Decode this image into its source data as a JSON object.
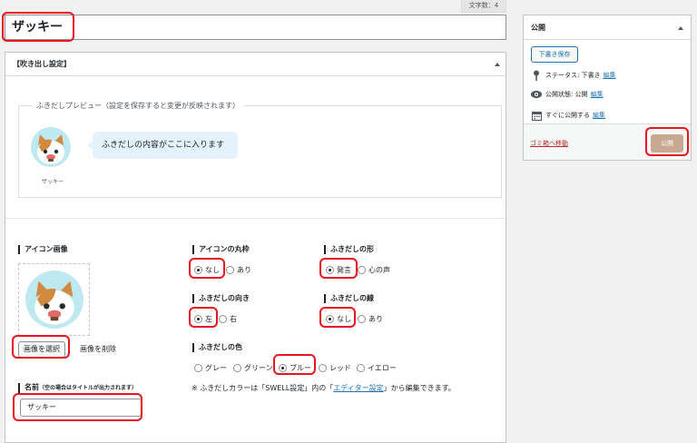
{
  "editor": {
    "char_count": "文字数：4",
    "title_value": "ザッキー"
  },
  "metabox": {
    "title": "【吹き出し設定】",
    "preview_label": "ふきだしプレビュー（設定を保存すると変更が反映されます）",
    "preview_text": "ふきだしの内容がここに入ります",
    "preview_name": "ザッキー",
    "icon_image_label": "アイコン画像",
    "select_image": "画像を選択",
    "remove_image": "画像を削除",
    "name_label": "名前",
    "name_hint": "（空の場合はタイトルが出力されます）",
    "name_value": "ザッキー",
    "icon_round_label": "アイコンの丸枠",
    "icon_round_options": [
      "なし",
      "あり"
    ],
    "bubble_shape_label": "ふきだしの形",
    "bubble_shape_options": [
      "発言",
      "心の声"
    ],
    "direction_label": "ふきだしの向き",
    "direction_options": [
      "左",
      "右"
    ],
    "border_label": "ふきだしの線",
    "border_options": [
      "なし",
      "あり"
    ],
    "color_label": "ふきだしの色",
    "color_options": [
      "グレー",
      "グリーン",
      "ブルー",
      "レッド",
      "イエロー"
    ],
    "note_before": "※ ふきだしカラーは「SWELL設定」内の「",
    "note_link": "エディター設定",
    "note_after": "」から編集できます。"
  },
  "publish": {
    "title": "公開",
    "save_draft": "下書き保存",
    "status_label": "ステータス: 下書き",
    "visibility_label": "公開状態: 公開",
    "schedule_label": "すぐに公開する",
    "edit": "編集",
    "trash": "ゴミ箱へ移動",
    "publish_button": "公開"
  },
  "colors": {
    "highlight": "#e8141e",
    "link": "#2271b1",
    "publish_button": "#c9a892",
    "bubble": "#e4f2fb",
    "avatar_bg": "#bfe9f0"
  }
}
